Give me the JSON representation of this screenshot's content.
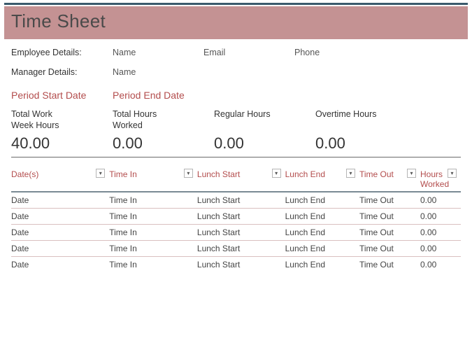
{
  "title": "Time Sheet",
  "employee": {
    "label": "Employee Details:",
    "fields": [
      "Name",
      "Email",
      "Phone"
    ]
  },
  "manager": {
    "label": "Manager Details:",
    "fields": [
      "Name"
    ]
  },
  "period": {
    "start": "Period Start Date",
    "end": "Period End Date"
  },
  "totals": [
    {
      "label": "Total Work\nWeek Hours",
      "value": "40.00"
    },
    {
      "label": "Total Hours\nWorked",
      "value": "0.00"
    },
    {
      "label": "Regular Hours",
      "value": "0.00"
    },
    {
      "label": "Overtime Hours",
      "value": "0.00"
    }
  ],
  "columns": [
    "Date(s)",
    "Time In",
    "Lunch Start",
    "Lunch End",
    "Time Out",
    "Hours Worked"
  ],
  "rows": [
    [
      "Date",
      "Time In",
      "Lunch Start",
      "Lunch End",
      "Time Out",
      "0.00"
    ],
    [
      "Date",
      "Time In",
      "Lunch Start",
      "Lunch End",
      "Time Out",
      "0.00"
    ],
    [
      "Date",
      "Time In",
      "Lunch Start",
      "Lunch End",
      "Time Out",
      "0.00"
    ],
    [
      "Date",
      "Time In",
      "Lunch Start",
      "Lunch End",
      "Time Out",
      "0.00"
    ],
    [
      "Date",
      "Time In",
      "Lunch Start",
      "Lunch End",
      "Time Out",
      "0.00"
    ]
  ],
  "colors": {
    "accent": "#b34d4d",
    "headerbg": "#c49293",
    "toprule": "#3a5a6c"
  }
}
